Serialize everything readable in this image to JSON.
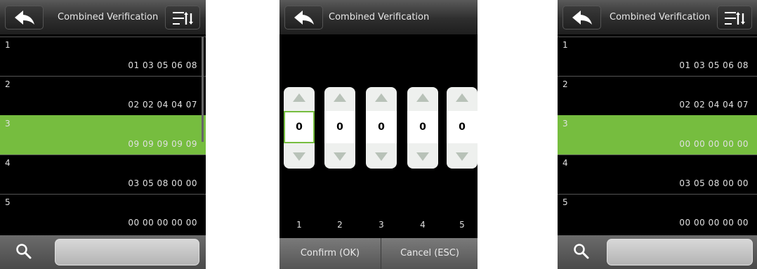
{
  "title": "Combined Verification",
  "left": {
    "rows": [
      {
        "num": "1",
        "code": "01 03 05 06 08"
      },
      {
        "num": "2",
        "code": "02 02 04 04 07"
      },
      {
        "num": "3",
        "code": "09 09 09 09 09"
      },
      {
        "num": "4",
        "code": "03 05 08 00 00"
      },
      {
        "num": "5",
        "code": "00 00 00 00 00"
      }
    ],
    "selected_row": "3"
  },
  "middle": {
    "spinners": [
      {
        "value": "0",
        "index": "1"
      },
      {
        "value": "0",
        "index": "2"
      },
      {
        "value": "0",
        "index": "3"
      },
      {
        "value": "0",
        "index": "4"
      },
      {
        "value": "0",
        "index": "5"
      }
    ],
    "confirm_label": "Confirm (OK)",
    "cancel_label": "Cancel (ESC)"
  },
  "right": {
    "rows": [
      {
        "num": "1",
        "code": "01 03 05 06 08"
      },
      {
        "num": "2",
        "code": "02 02 04 04 07"
      },
      {
        "num": "3",
        "code": "00 00 00 00 00"
      },
      {
        "num": "4",
        "code": "03 05 08 00 00"
      },
      {
        "num": "5",
        "code": "00 00 00 00 00"
      }
    ],
    "selected_row": "3"
  },
  "icons": {
    "back": "back-arrow-icon",
    "sort": "sort-icon",
    "search": "search-icon",
    "up": "triangle-up-icon",
    "down": "triangle-down-icon"
  },
  "colors": {
    "selection": "#76bd3f",
    "background": "#000000"
  }
}
